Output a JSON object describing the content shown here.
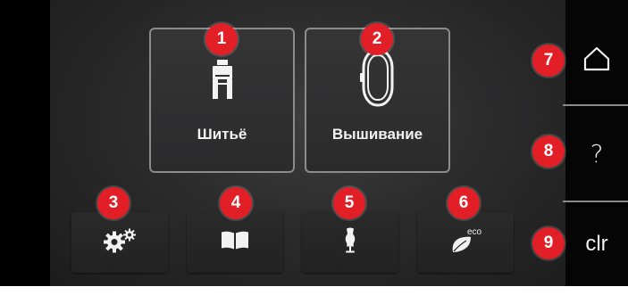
{
  "modes": [
    {
      "label": "Шитьё",
      "icon": "presser-foot-icon"
    },
    {
      "label": "Вышивание",
      "icon": "embroidery-hoop-icon"
    }
  ],
  "toolbar": [
    {
      "icon": "setup-gears-icon"
    },
    {
      "icon": "tutorial-book-icon"
    },
    {
      "icon": "creative-consultant-dress-form-icon"
    },
    {
      "icon": "eco-leaf-icon",
      "icon_text": "eco"
    }
  ],
  "side": {
    "home_icon": "home-icon",
    "help_label": "?",
    "clear_label": "clr"
  },
  "callouts": [
    "1",
    "2",
    "3",
    "4",
    "5",
    "6",
    "7",
    "8",
    "9"
  ],
  "colors": {
    "callout": "#e21f26",
    "background": "#2c2c2d",
    "panel": "#050505",
    "text": "#f2f2f2"
  }
}
